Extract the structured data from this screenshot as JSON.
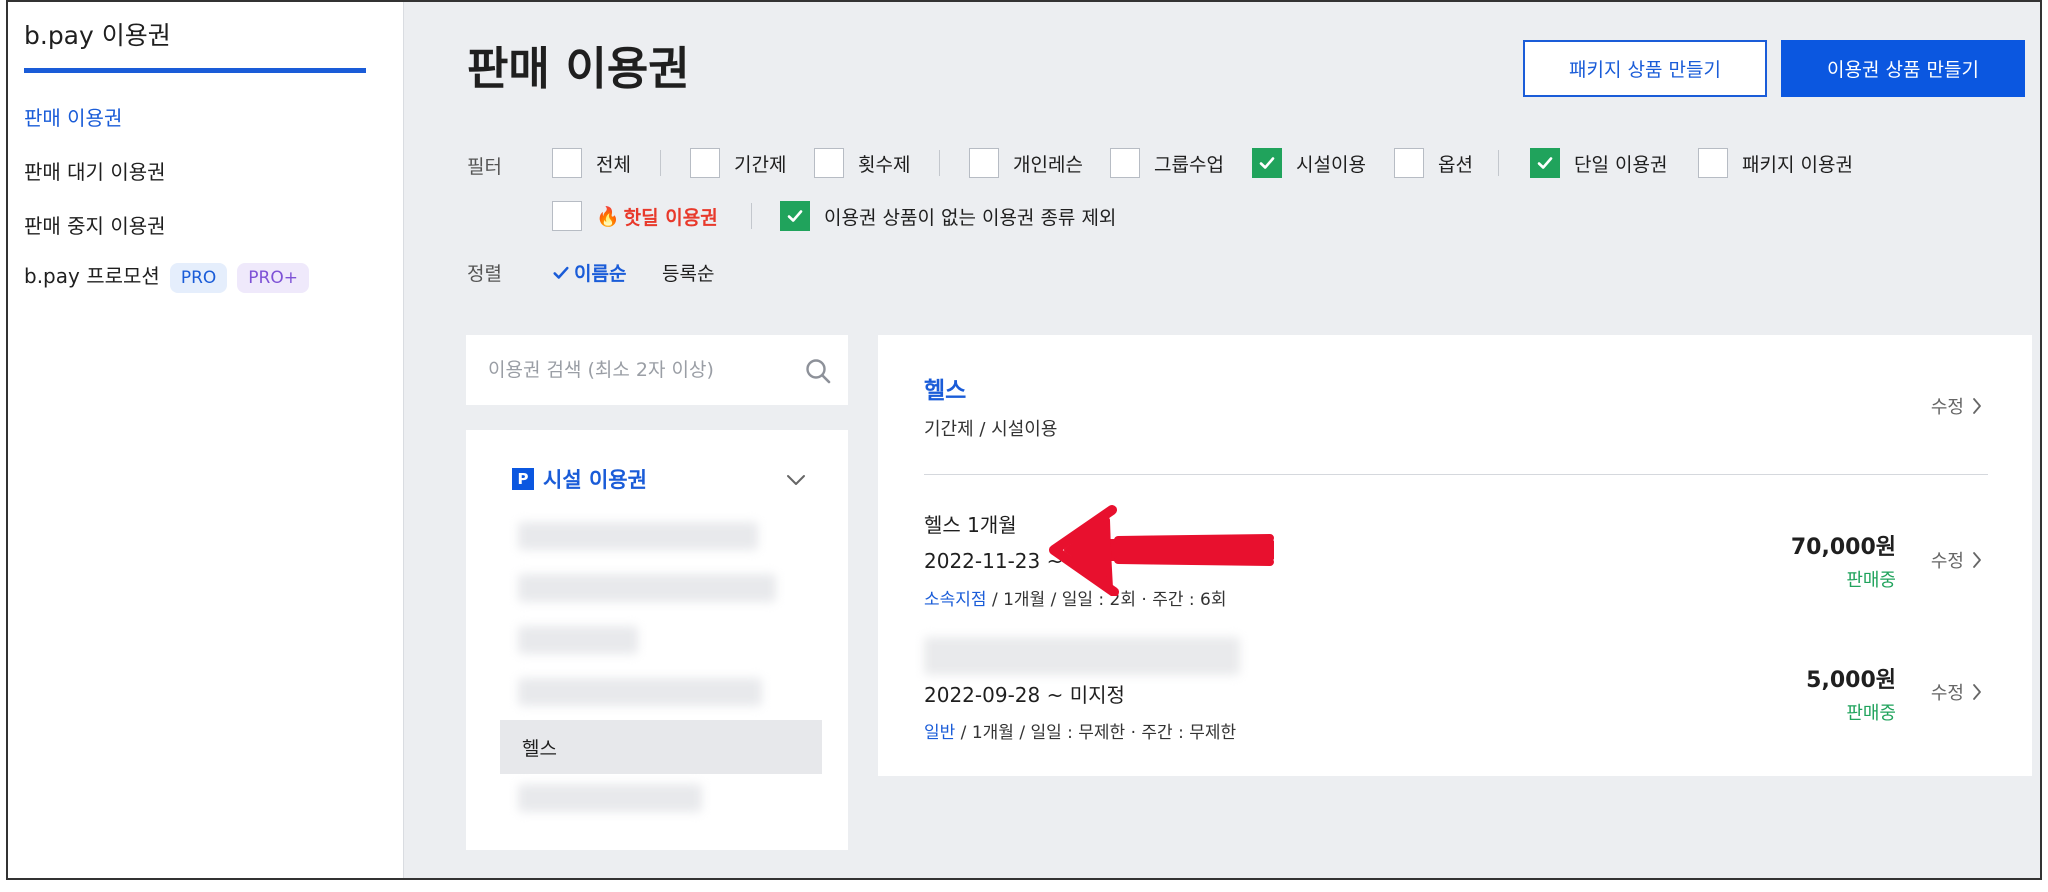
{
  "sidebar": {
    "title": "b.pay 이용권",
    "items": [
      {
        "label": "판매 이용권"
      },
      {
        "label": "판매 대기 이용권"
      },
      {
        "label": "판매 중지 이용권"
      },
      {
        "label": "b.pay 프로모션",
        "badges": [
          "PRO",
          "PRO+"
        ]
      }
    ]
  },
  "header": {
    "title": "판매 이용권",
    "package_button": "패키지 상품 만들기",
    "create_button": "이용권 상품 만들기"
  },
  "filter": {
    "label": "필터",
    "options": [
      {
        "label": "전체",
        "checked": false
      },
      {
        "label": "기간제",
        "checked": false
      },
      {
        "label": "횟수제",
        "checked": false
      },
      {
        "label": "개인레슨",
        "checked": false
      },
      {
        "label": "그룹수업",
        "checked": false
      },
      {
        "label": "시설이용",
        "checked": true
      },
      {
        "label": "옵션",
        "checked": false
      },
      {
        "label": "단일 이용권",
        "checked": true
      },
      {
        "label": "패키지 이용권",
        "checked": false
      },
      {
        "label": "핫딜 이용권",
        "checked": false
      },
      {
        "label": "이용권 상품이 없는 이용권 종류 제외",
        "checked": true
      }
    ]
  },
  "sort": {
    "label": "정렬",
    "options": [
      "이름순",
      "등록순"
    ],
    "selected": "이름순"
  },
  "search": {
    "placeholder": "이용권 검색 (최소 2자 이상)"
  },
  "list": {
    "category_badge": "P",
    "category": "시설 이용권",
    "selected_item": "헬스"
  },
  "detail": {
    "title": "헬스",
    "subtitle": "기간제 / 시설이용",
    "edit_label": "수정",
    "products": [
      {
        "name": "헬스 1개월",
        "date": "2022-11-23 ~ 미",
        "branch": "소속지점",
        "meta": " / 1개월 / 일일 : 2회 · 주간 : 6회",
        "price": "70,000원",
        "status": "판매중"
      },
      {
        "name": "",
        "date": "2022-09-28 ~ 미지정",
        "branch": "일반",
        "meta": " / 1개월 / 일일 : 무제한 · 주간 : 무제한",
        "price": "5,000원",
        "status": "판매중"
      }
    ]
  },
  "colors": {
    "accent": "#1a5cd8",
    "primary_button": "#0b57e0",
    "check_green": "#20a35c",
    "hotdeal_red": "#e8392b",
    "annotation_arrow": "#e8102e"
  },
  "icons": {
    "search": "search-icon",
    "chevron_down": "chevron-down-icon",
    "chevron_right": "chevron-right-icon",
    "check": "check-icon",
    "fire": "fire-icon",
    "arrow": "red-arrow-annotation"
  }
}
